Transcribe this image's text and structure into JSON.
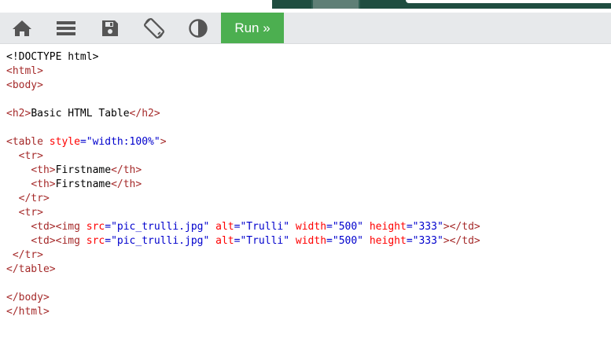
{
  "toolbar": {
    "icons": [
      "home-icon",
      "menu-icon",
      "save-icon",
      "rotate-icon",
      "contrast-icon"
    ],
    "run_label": "Run »",
    "colors": {
      "toolbar_bg": "#e7e9eb",
      "icon": "#555555",
      "run_bg": "#4caf50"
    }
  },
  "code": {
    "colors": {
      "tag": "#a52a2a",
      "attribute": "#ff0000",
      "value": "#0000cd",
      "text": "#000000"
    },
    "lines": [
      [
        [
          "p",
          "<!DOCTYPE html>"
        ]
      ],
      [
        [
          "t",
          "<html>"
        ]
      ],
      [
        [
          "t",
          "<body>"
        ]
      ],
      [],
      [
        [
          "t",
          "<h2>"
        ],
        [
          "p",
          "Basic HTML Table"
        ],
        [
          "t",
          "</h2>"
        ]
      ],
      [],
      [
        [
          "t",
          "<table "
        ],
        [
          "a",
          "style"
        ],
        [
          "v",
          "=\"width:100%\""
        ],
        [
          "t",
          ">"
        ]
      ],
      [
        [
          "p",
          "  "
        ],
        [
          "t",
          "<tr>"
        ]
      ],
      [
        [
          "p",
          "    "
        ],
        [
          "t",
          "<th>"
        ],
        [
          "p",
          "Firstname"
        ],
        [
          "t",
          "</th>"
        ]
      ],
      [
        [
          "p",
          "    "
        ],
        [
          "t",
          "<th>"
        ],
        [
          "p",
          "Firstname"
        ],
        [
          "t",
          "</th>"
        ]
      ],
      [
        [
          "p",
          "  "
        ],
        [
          "t",
          "</tr>"
        ]
      ],
      [
        [
          "p",
          "  "
        ],
        [
          "t",
          "<tr>"
        ]
      ],
      [
        [
          "p",
          "    "
        ],
        [
          "t",
          "<td><img "
        ],
        [
          "a",
          "src"
        ],
        [
          "v",
          "=\"pic_trulli.jpg\""
        ],
        [
          "a",
          " alt"
        ],
        [
          "v",
          "=\"Trulli\""
        ],
        [
          "a",
          " width"
        ],
        [
          "v",
          "=\"500\""
        ],
        [
          "a",
          " height"
        ],
        [
          "v",
          "=\"333\""
        ],
        [
          "t",
          "></td>"
        ]
      ],
      [
        [
          "p",
          "    "
        ],
        [
          "t",
          "<td><img "
        ],
        [
          "a",
          "src"
        ],
        [
          "v",
          "=\"pic_trulli.jpg\""
        ],
        [
          "a",
          " alt"
        ],
        [
          "v",
          "=\"Trulli\""
        ],
        [
          "a",
          " width"
        ],
        [
          "v",
          "=\"500\""
        ],
        [
          "a",
          " height"
        ],
        [
          "v",
          "=\"333\""
        ],
        [
          "t",
          "></td>"
        ]
      ],
      [
        [
          "p",
          " "
        ],
        [
          "t",
          "</tr>"
        ]
      ],
      [
        [
          "t",
          "</table>"
        ]
      ],
      [],
      [
        [
          "t",
          "</body>"
        ]
      ],
      [
        [
          "t",
          "</html>"
        ]
      ]
    ]
  }
}
